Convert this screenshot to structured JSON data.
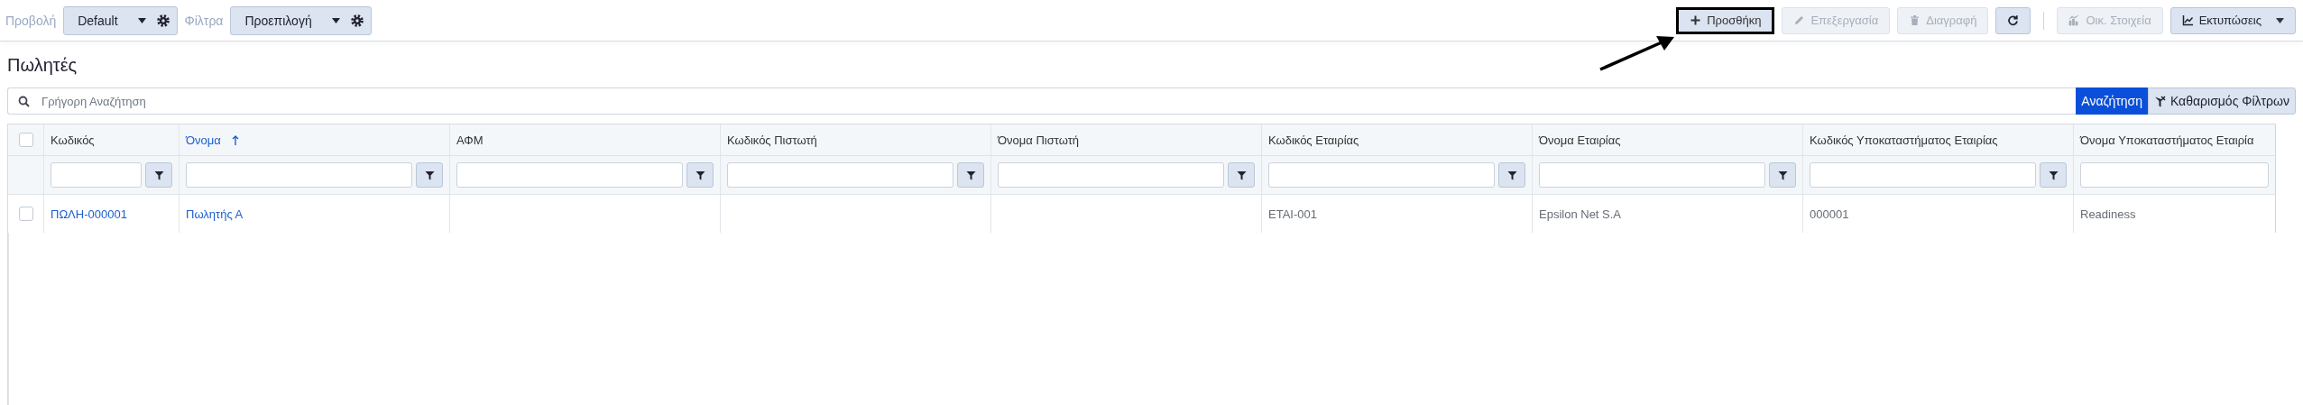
{
  "toolbar": {
    "view_label": "Προβολή",
    "view": {
      "value": "Default"
    },
    "filter_label": "Φίλτρα",
    "filter": {
      "value": "Προεπιλογή"
    },
    "actions": [
      {
        "kind": "add",
        "label": "Προσθήκη",
        "disabled": false,
        "highlighted": true
      },
      {
        "kind": "edit",
        "label": "Επεξεργασία",
        "disabled": true,
        "highlighted": false
      },
      {
        "kind": "delete",
        "label": "Διαγραφή",
        "disabled": true,
        "highlighted": false
      },
      {
        "kind": "refresh",
        "disabled": false,
        "highlighted": false
      }
    ],
    "reports": [
      {
        "kind": "financial",
        "label": "Οικ. Στοιχεία",
        "disabled": true
      },
      {
        "kind": "prints",
        "label": "Εκτυπώσεις",
        "disabled": false
      }
    ]
  },
  "annotations": [
    {
      "kind": "arrow"
    }
  ],
  "page_title": "Πωλητές",
  "search": {
    "placeholder": "Γρήγορη Αναζήτηση",
    "search_button": "Αναζήτηση",
    "clear_button": "Καθαρισμός Φίλτρων"
  },
  "table": {
    "select_all": {
      "checked": false
    },
    "columns": [
      {
        "label": "Κωδικός",
        "sorted": false,
        "filter_button": true
      },
      {
        "label": "Όνομα",
        "sorted": true,
        "filter_button": true
      },
      {
        "label": "ΑΦΜ",
        "sorted": false,
        "filter_button": true
      },
      {
        "label": "Κωδικός Πιστωτή",
        "sorted": false,
        "filter_button": true
      },
      {
        "label": "Όνομα Πιστωτή",
        "sorted": false,
        "filter_button": true
      },
      {
        "label": "Κωδικός Εταιρίας",
        "sorted": false,
        "filter_button": true
      },
      {
        "label": "Όνομα Εταιρίας",
        "sorted": false,
        "filter_button": true
      },
      {
        "label": "Κωδικός Υποκαταστήματος Εταιρίας",
        "sorted": false,
        "filter_button": true
      },
      {
        "label": "Όνομα Υποκαταστήματος Εταιρία",
        "sorted": false,
        "filter_button": false
      }
    ],
    "rows": [
      {
        "checked": false,
        "cells": [
          {
            "kind": "link",
            "text": "ΠΩΛΗ-000001"
          },
          {
            "kind": "link",
            "text": "Πωλητής Α"
          },
          {
            "kind": "empty"
          },
          {
            "kind": "empty"
          },
          {
            "kind": "empty"
          },
          {
            "kind": "text",
            "text": "ETAI-001"
          },
          {
            "kind": "text",
            "text": "Epsilon Net S.A"
          },
          {
            "kind": "text",
            "text": "000001"
          },
          {
            "kind": "text",
            "text": "Readiness"
          }
        ]
      }
    ]
  }
}
